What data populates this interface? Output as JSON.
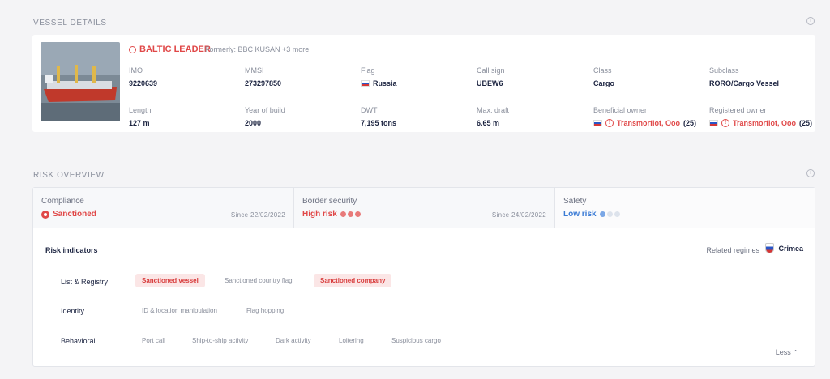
{
  "vessel_details": {
    "section_title": "VESSEL DETAILS",
    "name": "BALTIC LEADER",
    "formerly": "Formerly: BBC KUSAN +3 more",
    "fields": [
      {
        "label": "IMO",
        "value": "9220639"
      },
      {
        "label": "MMSI",
        "value": "273297850"
      },
      {
        "label": "Flag",
        "value": "Russia"
      },
      {
        "label": "Call sign",
        "value": "UBEW6"
      },
      {
        "label": "Class",
        "value": "Cargo"
      },
      {
        "label": "Subclass",
        "value": "RORO/Cargo Vessel"
      },
      {
        "label": "Length",
        "value": "127 m"
      },
      {
        "label": "Year of build",
        "value": "2000"
      },
      {
        "label": "DWT",
        "value": "7,195 tons"
      },
      {
        "label": "Max. draft",
        "value": "6.65 m"
      },
      {
        "label": "Beneficial owner",
        "value": "Transmorflot, Ooo",
        "count": "(25)"
      },
      {
        "label": "Registered owner",
        "value": "Transmorflot, Ooo",
        "count": "(25)"
      }
    ]
  },
  "risk_overview": {
    "section_title": "RISK OVERVIEW",
    "tabs": [
      {
        "label": "Compliance",
        "status": "Sanctioned",
        "since": "Since 22/02/2022",
        "color": "#e04848"
      },
      {
        "label": "Border security",
        "status": "High risk",
        "since": "Since 24/02/2022",
        "color": "#e04848"
      },
      {
        "label": "Safety",
        "status": "Low risk",
        "since": "",
        "color": "#3a7bd5"
      }
    ],
    "risk_indicators_title": "Risk indicators",
    "related_regimes_label": "Related regimes",
    "regime": "Crimea",
    "rows": [
      {
        "label": "List & Registry",
        "tags": [
          {
            "text": "Sanctioned vessel",
            "active": true
          },
          {
            "text": "Sanctioned country flag",
            "active": false
          },
          {
            "text": "Sanctioned company",
            "active": true
          }
        ]
      },
      {
        "label": "Identity",
        "tags": [
          {
            "text": "ID & location manipulation",
            "active": false
          },
          {
            "text": "Flag hopping",
            "active": false
          }
        ]
      },
      {
        "label": "Behavioral",
        "tags": [
          {
            "text": "Port call",
            "active": false
          },
          {
            "text": "Ship-to-ship activity",
            "active": false
          },
          {
            "text": "Dark activity",
            "active": false
          },
          {
            "text": "Loitering",
            "active": false
          },
          {
            "text": "Suspicious cargo",
            "active": false
          }
        ]
      }
    ],
    "less_label": "Less"
  }
}
